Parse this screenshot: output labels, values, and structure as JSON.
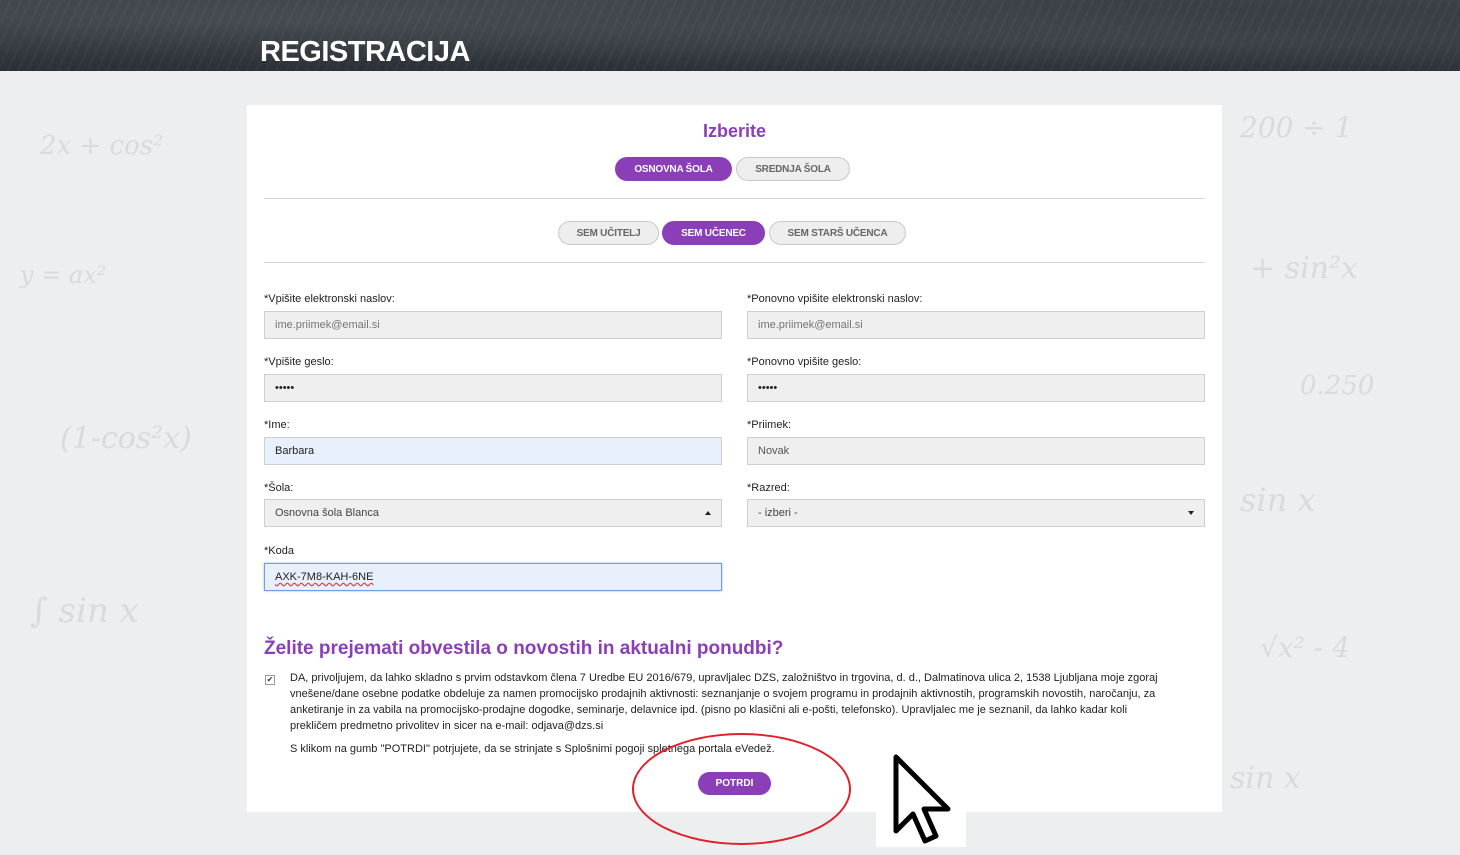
{
  "header": {
    "title": "REGISTRACIJA"
  },
  "form": {
    "heading": "Izberite",
    "school_tabs": [
      "OSNOVNA ŠOLA",
      "SREDNJA ŠOLA"
    ],
    "role_tabs": [
      "SEM UČITELJ",
      "SEM UČENEC",
      "SEM STARŠ UČENCA"
    ],
    "fields": {
      "email": {
        "label": "*Vpišite elektronski naslov:",
        "placeholder": "ime.priimek@email.si"
      },
      "email_repeat": {
        "label": "*Ponovno vpišite elektronski naslov:",
        "placeholder": "ime.priimek@email.si"
      },
      "password": {
        "label": "*Vpišite geslo:",
        "value": "•••••"
      },
      "password_repeat": {
        "label": "*Ponovno vpišite geslo:",
        "value": "•••••"
      },
      "first_name": {
        "label": "*Ime:",
        "value": "Barbara"
      },
      "last_name": {
        "label": "*Priimek:",
        "value": "Novak"
      },
      "school": {
        "label": "*Šola:",
        "value": "Osnovna šola Blanca"
      },
      "grade": {
        "label": "*Razred:",
        "value": "- izberi -"
      },
      "code": {
        "label": "*Koda",
        "value": "AXK-7M8-KAH-6NE"
      }
    },
    "newsletter": {
      "title": "Želite prejemati obvestila o novostih in aktualni ponudbi?",
      "checked": true,
      "checkbox_mark": "✔",
      "consent_text": "DA, privoljujem, da lahko skladno s prvim odstavkom člena 7 Uredbe EU 2016/679, upravljalec DZS, založništvo in trgovina, d. d., Dalmatinova ulica 2,  1538 Ljubljana moje zgoraj vnešene/dane osebne podatke obdeluje za namen promocijsko prodajnih aktivnosti: seznanjanje o svojem programu in prodajnih aktivnostih,  programskih novostih, naročanju, za anketiranje in za vabila na promocijsko-prodajne dogodke, seminarje, delavnice ipd. (pisno po klasični ali e-pošti, telefonsko).  Upravljalec me je seznanil, da lahko kadar koli prekličem predmetno privolitev in sicer na e-mail: odjava@dzs.si"
    },
    "terms_text": "S klikom na gumb \"POTRDI\" potrjujete, da se strinjate s Splošnimi pogoji spletnega portala eVedež.",
    "submit_label": "POTRDI"
  },
  "colors": {
    "accent": "#8a3fb8",
    "annotation": "#e0202a"
  }
}
